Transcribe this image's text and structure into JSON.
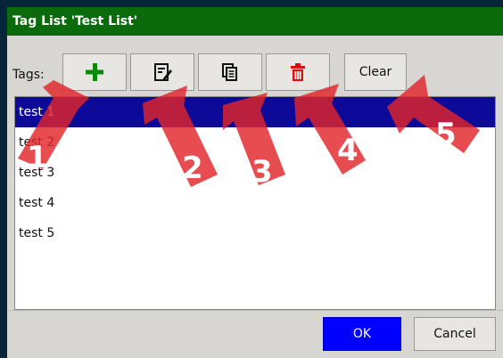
{
  "dialog": {
    "title": "Tag List 'Test List'",
    "title_bg": "#0a6a0c"
  },
  "toolbar": {
    "tags_label": "Tags:",
    "add_icon": "plus-icon",
    "edit_icon": "edit-note-icon",
    "copy_icon": "copy-icon",
    "delete_icon": "trash-icon",
    "clear_label": "Clear"
  },
  "list": {
    "items": [
      "test 1",
      "test 2",
      "test 3",
      "test 4",
      "test 5"
    ],
    "selected_index": 0,
    "selected_bg": "#0d0a9a"
  },
  "footer": {
    "ok_label": "OK",
    "cancel_label": "Cancel",
    "ok_bg": "#0000ff"
  },
  "annotations": {
    "arrow_color": "#e0242a",
    "labels": [
      "1",
      "2",
      "3",
      "4",
      "5"
    ]
  }
}
